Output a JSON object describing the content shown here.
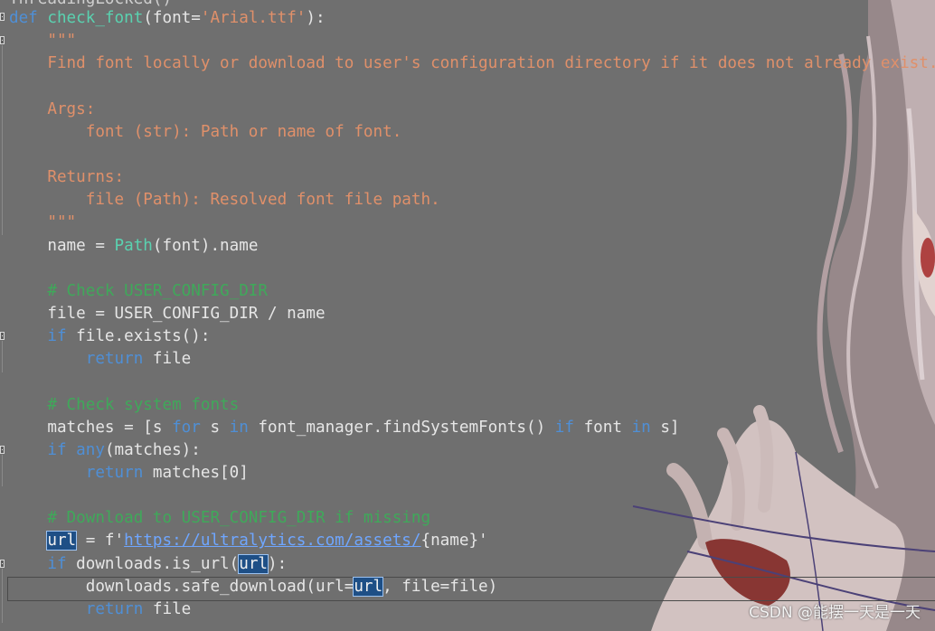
{
  "editor": {
    "partial_line": "ThreadingLocked()",
    "lines": [
      {
        "parts": [
          {
            "t": "def ",
            "c": "kw"
          },
          {
            "t": "check_font",
            "c": "fn"
          },
          {
            "t": "(font=",
            "c": "op"
          },
          {
            "t": "'Arial.ttf'",
            "c": "str"
          },
          {
            "t": "):",
            "c": "op"
          }
        ]
      },
      {
        "parts": [
          {
            "t": "    \"\"\"",
            "c": "doc"
          }
        ]
      },
      {
        "parts": [
          {
            "t": "    Find font locally or download to user's configuration directory if it does not already exist.",
            "c": "doc"
          }
        ]
      },
      {
        "parts": []
      },
      {
        "parts": [
          {
            "t": "    Args:",
            "c": "doc"
          }
        ]
      },
      {
        "parts": [
          {
            "t": "        font (str): Path or name of font.",
            "c": "doc"
          }
        ]
      },
      {
        "parts": []
      },
      {
        "parts": [
          {
            "t": "    Returns:",
            "c": "doc"
          }
        ]
      },
      {
        "parts": [
          {
            "t": "        file (Path): Resolved font file path.",
            "c": "doc"
          }
        ]
      },
      {
        "parts": [
          {
            "t": "    \"\"\"",
            "c": "doc"
          }
        ]
      },
      {
        "parts": [
          {
            "t": "    name = ",
            "c": "op"
          },
          {
            "t": "Path",
            "c": "fn"
          },
          {
            "t": "(font).name",
            "c": "op"
          }
        ]
      },
      {
        "parts": []
      },
      {
        "parts": [
          {
            "t": "    # Check USER_CONFIG_DIR",
            "c": "cm"
          }
        ]
      },
      {
        "parts": [
          {
            "t": "    file = USER_CONFIG_DIR / name",
            "c": "op"
          }
        ]
      },
      {
        "parts": [
          {
            "t": "    ",
            "c": "op"
          },
          {
            "t": "if",
            "c": "kw"
          },
          {
            "t": " file.exists():",
            "c": "op"
          }
        ]
      },
      {
        "parts": [
          {
            "t": "        ",
            "c": "op"
          },
          {
            "t": "return",
            "c": "kw"
          },
          {
            "t": " file",
            "c": "op"
          }
        ]
      },
      {
        "parts": []
      },
      {
        "parts": [
          {
            "t": "    # Check system fonts",
            "c": "cm"
          }
        ]
      },
      {
        "parts": [
          {
            "t": "    matches = [s ",
            "c": "op"
          },
          {
            "t": "for",
            "c": "kw"
          },
          {
            "t": " s ",
            "c": "op"
          },
          {
            "t": "in",
            "c": "kw"
          },
          {
            "t": " font_manager.findSystemFonts() ",
            "c": "op"
          },
          {
            "t": "if",
            "c": "kw"
          },
          {
            "t": " font ",
            "c": "op"
          },
          {
            "t": "in",
            "c": "kw"
          },
          {
            "t": " s]",
            "c": "op"
          }
        ]
      },
      {
        "parts": [
          {
            "t": "    ",
            "c": "op"
          },
          {
            "t": "if",
            "c": "kw"
          },
          {
            "t": " ",
            "c": "op"
          },
          {
            "t": "any",
            "c": "kw"
          },
          {
            "t": "(matches):",
            "c": "op"
          }
        ]
      },
      {
        "parts": [
          {
            "t": "        ",
            "c": "op"
          },
          {
            "t": "return",
            "c": "kw"
          },
          {
            "t": " matches[0]",
            "c": "op"
          }
        ]
      },
      {
        "parts": []
      },
      {
        "parts": [
          {
            "t": "    # Download to USER_CONFIG_DIR if missing",
            "c": "cm"
          }
        ]
      },
      {
        "parts": [
          {
            "t": "    ",
            "c": "op"
          },
          {
            "t": "url",
            "c": "hl"
          },
          {
            "t": " = f'",
            "c": "op"
          },
          {
            "t": "https://ultralytics.com/assets/",
            "c": "link"
          },
          {
            "t": "{name}'",
            "c": "op"
          }
        ]
      },
      {
        "parts": [
          {
            "t": "    ",
            "c": "op"
          },
          {
            "t": "if",
            "c": "kw"
          },
          {
            "t": " downloads.is_url(",
            "c": "op"
          },
          {
            "t": "url",
            "c": "hl"
          },
          {
            "t": "):",
            "c": "op"
          }
        ]
      },
      {
        "parts": [
          {
            "t": "        downloads.safe_download(url=",
            "c": "op"
          },
          {
            "t": "url",
            "c": "hl"
          },
          {
            "t": ", file=file)",
            "c": "op"
          }
        ]
      },
      {
        "parts": [
          {
            "t": "        ",
            "c": "op"
          },
          {
            "t": "return",
            "c": "kw"
          },
          {
            "t": " file",
            "c": "op"
          }
        ]
      }
    ]
  },
  "watermark": "CSDN @能摆一天是一天"
}
